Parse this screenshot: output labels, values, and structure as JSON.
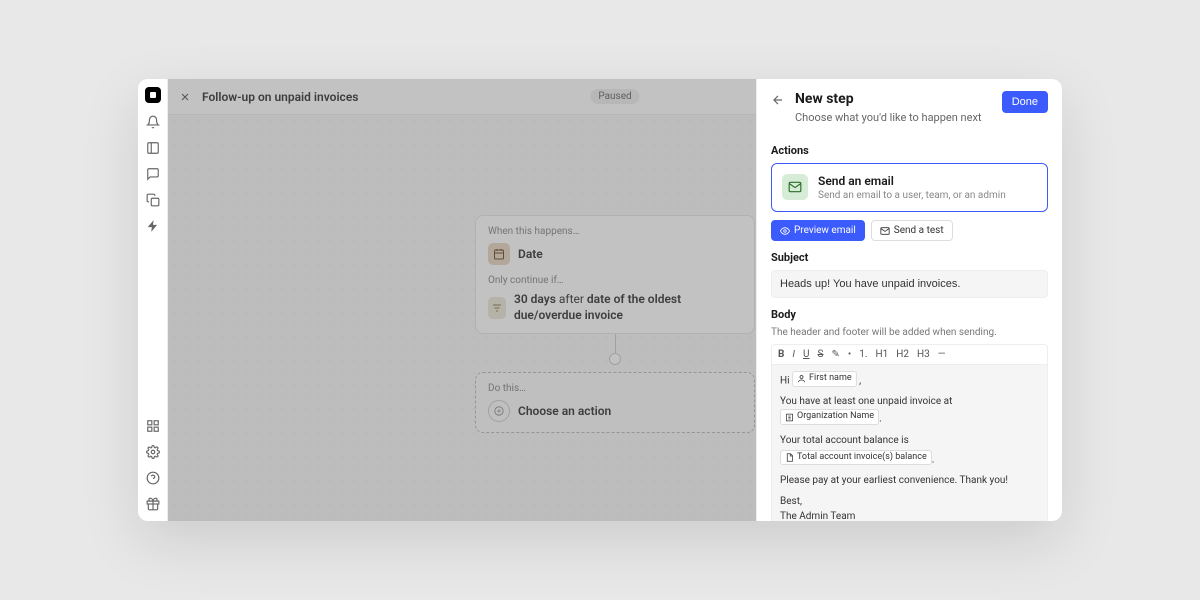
{
  "header": {
    "title": "Follow-up on unpaid invoices",
    "status": "Paused"
  },
  "flow": {
    "trigger_label": "When this happens…",
    "trigger_value": "Date",
    "condition_label": "Only continue if…",
    "condition_days": "30 days",
    "condition_after": " after ",
    "condition_target": "date of the oldest due/overdue invoice",
    "action_label": "Do this…",
    "action_placeholder": "Choose an action"
  },
  "panel": {
    "title": "New step",
    "subtitle": "Choose what you'd like to happen next",
    "done": "Done",
    "actions_label": "Actions",
    "action_card": {
      "title": "Send an email",
      "desc": "Send an email to a user, team, or an admin"
    },
    "preview_btn": "Preview email",
    "test_btn": "Send a test",
    "subject_label": "Subject",
    "subject_value": "Heads up! You have unpaid invoices.",
    "body_label": "Body",
    "body_hint": "The header and footer will be added when sending.",
    "toolbar": [
      "B",
      "I",
      "U",
      "S",
      "✎",
      "•",
      "1.",
      "H1",
      "H2",
      "H3",
      "—"
    ],
    "body": {
      "greeting_prefix": "Hi ",
      "token_first_name": "First name",
      "line1_prefix": "You have at least one unpaid invoice at ",
      "token_org": "Organization Name",
      "line1_suffix": ".",
      "line2": "Your total account balance is",
      "token_balance": "Total account invoice(s) balance",
      "line2_suffix": ".",
      "line3": "Please pay at your earliest convenience. Thank you!",
      "signoff1": "Best,",
      "signoff2": "The Admin Team"
    }
  }
}
